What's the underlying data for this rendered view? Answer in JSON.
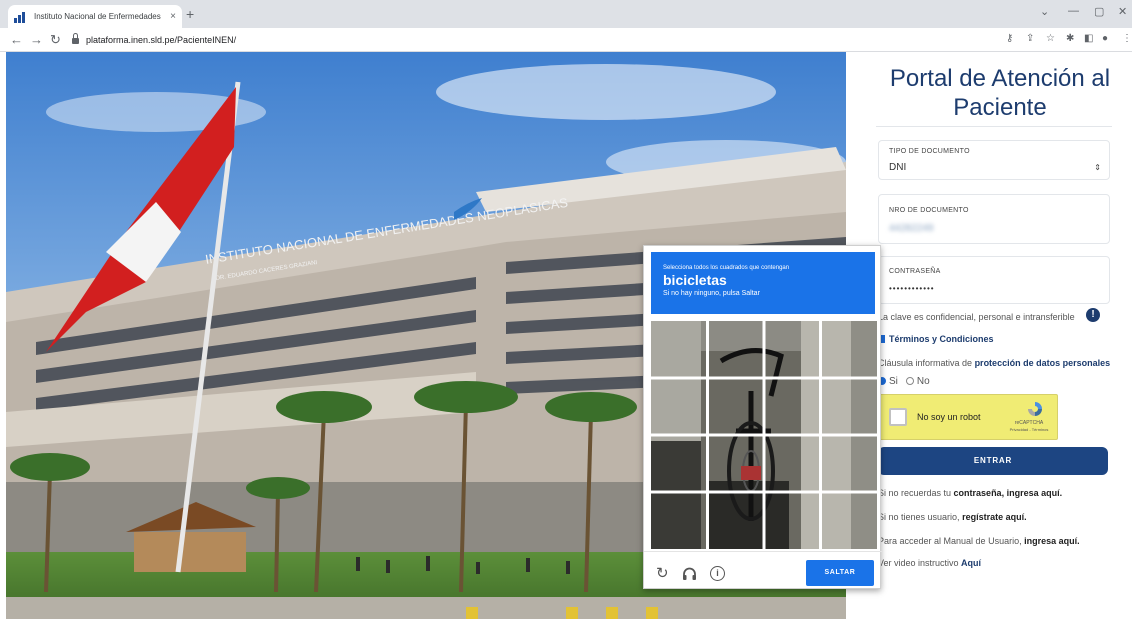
{
  "browser": {
    "tab_title": "Instituto Nacional de Enfermedades",
    "tab_close": "×",
    "new_tab": "+",
    "url": "plataforma.inen.sld.pe/PacienteINEN/",
    "window_controls": [
      "⌄",
      "—",
      "▢",
      "✕"
    ]
  },
  "hero": {
    "building_sign": "INSTITUTO NACIONAL DE ENFERMEDADES NEOPLASICAS",
    "building_subsign": "DR. EDUARDO CACERES GRAZIANI"
  },
  "form": {
    "title": "Portal de Atención al Paciente",
    "doc_type": {
      "label": "TIPO DE DOCUMENTO",
      "value": "DNI"
    },
    "doc_number": {
      "label": "NRO DE DOCUMENTO",
      "value": "44282249"
    },
    "password": {
      "label": "CONTRASEÑA",
      "value": "••••••••••••"
    },
    "confidential_note": "La clave es confidencial, personal e intransferible",
    "terms_label": "Términos y Condiciones",
    "clause": {
      "prefix": "Cláusula informativa de ",
      "link": "protección de datos personales"
    },
    "consent": {
      "yes": "Si",
      "no": "No"
    },
    "recaptcha": {
      "label": "No soy un robot",
      "brand": "reCAPTCHA",
      "terms": "Privacidad - Términos"
    },
    "submit_label": "ENTRAR",
    "help_links": [
      {
        "prefix": "Si no recuerdas tu ",
        "strong": "contraseña, ingresa aquí.",
        "suffix": ""
      },
      {
        "prefix": "Si no tienes usuario, ",
        "strong": "regístrate aquí.",
        "suffix": ""
      },
      {
        "prefix": "Para acceder al Manual de Usuario, ",
        "strong": "ingresa aquí.",
        "suffix": ""
      },
      {
        "prefix": "Ver video instructivo ",
        "strong": "Aquí",
        "suffix": ""
      }
    ]
  },
  "captcha": {
    "intro": "Selecciona todos los cuadrados que contengan",
    "object": "bicicletas",
    "skip_hint": "Si no hay ninguno, pulsa Saltar",
    "skip_label": "SALTAR",
    "icons": [
      "reload-icon",
      "headphones-icon",
      "info-icon"
    ]
  },
  "colors": {
    "brand_blue": "#1d3c6e",
    "button_blue": "#1d4582",
    "captcha_blue": "#1a73e8",
    "recaptcha_yellow": "#f0ec74"
  }
}
